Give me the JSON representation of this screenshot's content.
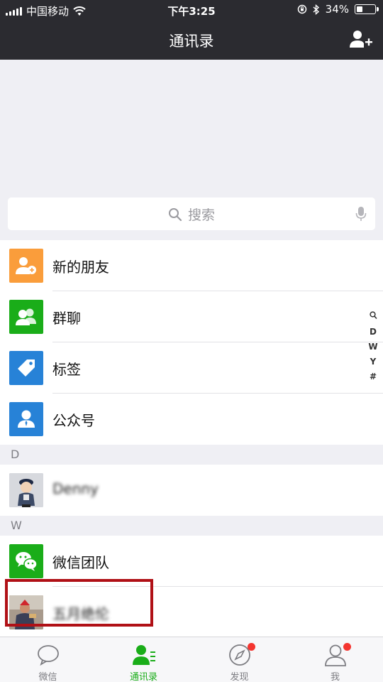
{
  "status_bar": {
    "carrier": "中国移动",
    "time": "下午3:25",
    "battery_percent_text": "34%",
    "battery_level": 0.34
  },
  "nav": {
    "title": "通讯录",
    "add_icon": "add-contact-icon"
  },
  "search": {
    "placeholder": "搜索",
    "icon": "search-icon",
    "voice_icon": "microphone-icon"
  },
  "features": [
    {
      "label": "新的朋友",
      "icon": "new-friend-icon",
      "color": "#fa9d3b"
    },
    {
      "label": "群聊",
      "icon": "group-chat-icon",
      "color": "#1aad19"
    },
    {
      "label": "标签",
      "icon": "tag-icon",
      "color": "#2782d7"
    },
    {
      "label": "公众号",
      "icon": "official-account-icon",
      "color": "#2782d7"
    }
  ],
  "sections": [
    {
      "letter": "D",
      "contacts": [
        {
          "name": "Denny",
          "blurred": true
        }
      ]
    },
    {
      "letter": "W",
      "contacts": [
        {
          "name": "微信团队",
          "blurred": false,
          "icon": "wechat-team-icon",
          "color": "#1aad19"
        },
        {
          "name": "五月绝伦",
          "blurred": true
        }
      ]
    }
  ],
  "index_letters": [
    "D",
    "W",
    "Y",
    "#"
  ],
  "index_search_icon": "search-icon",
  "tabs": [
    {
      "label": "微信",
      "icon": "chat-bubble-icon",
      "active": false,
      "badge": false
    },
    {
      "label": "通讯录",
      "icon": "contacts-icon",
      "active": true,
      "badge": false
    },
    {
      "label": "发现",
      "icon": "compass-icon",
      "active": false,
      "badge": true
    },
    {
      "label": "我",
      "icon": "profile-icon",
      "active": false,
      "badge": true
    }
  ],
  "colors": {
    "bar_dark": "#2b2b30",
    "active_green": "#1aad19",
    "badge_red": "#f43530",
    "highlight_red": "#b01016"
  }
}
